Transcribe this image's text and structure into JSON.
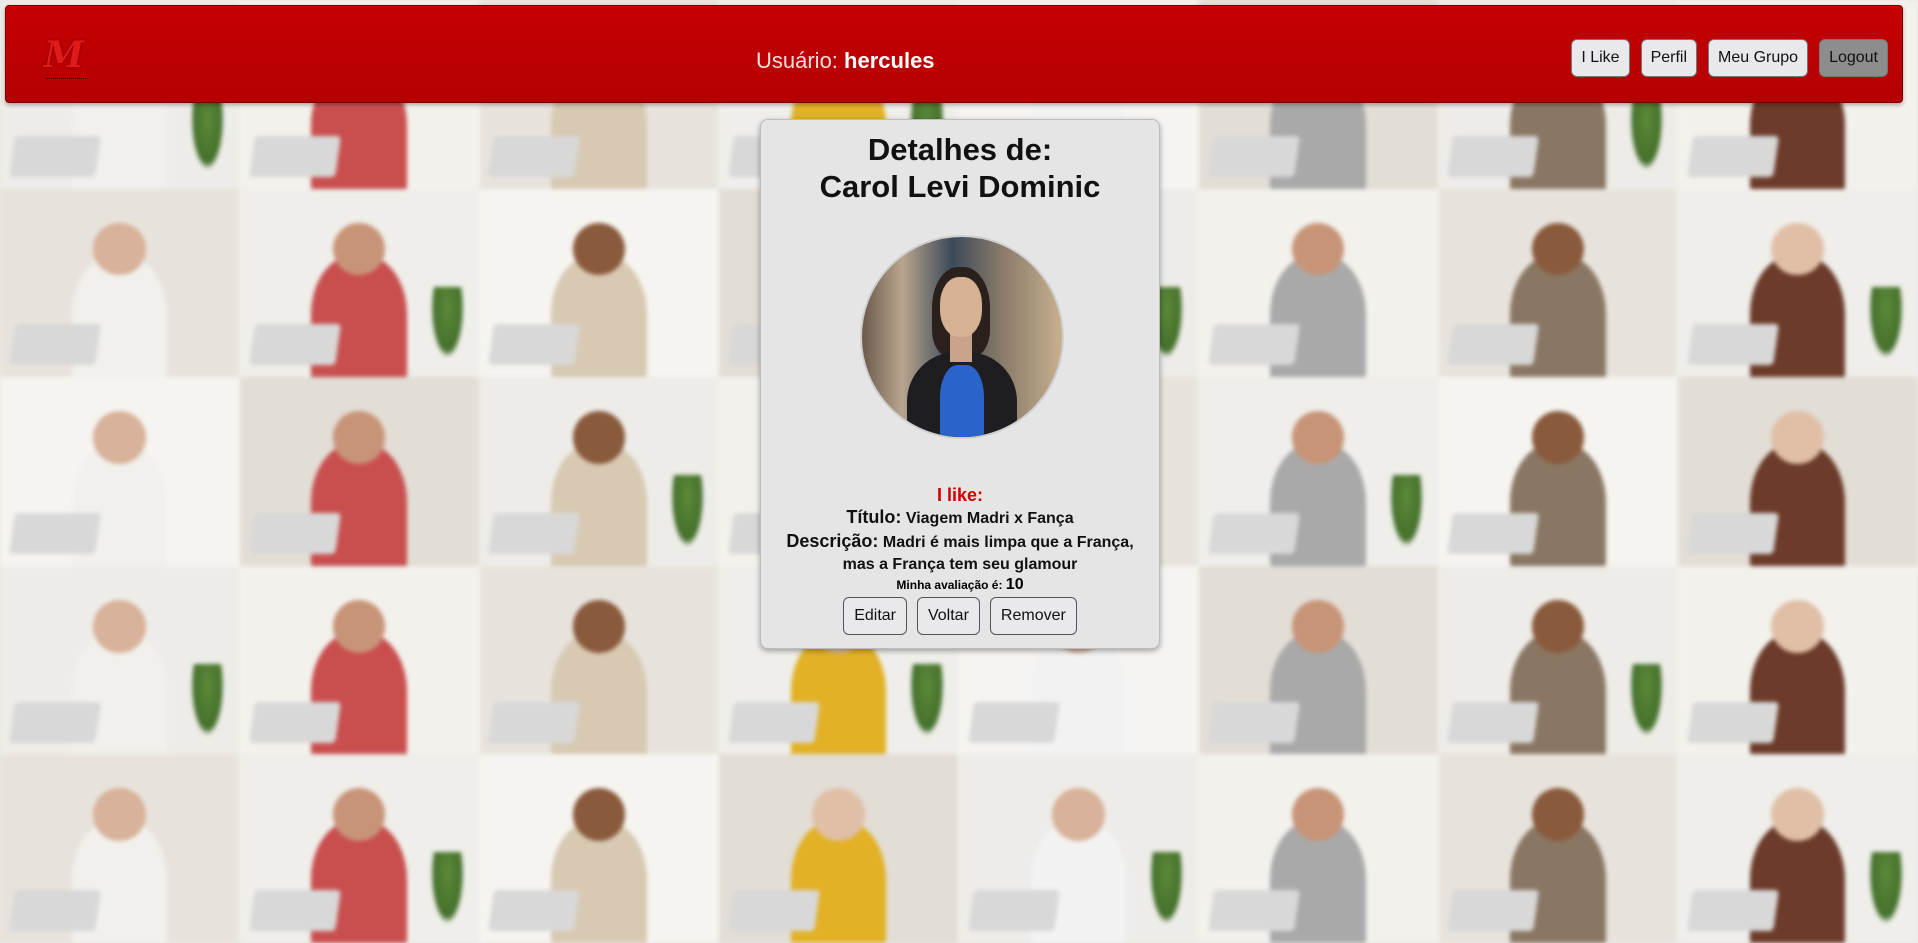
{
  "header": {
    "logo_letter": "M",
    "user_prefix": "Usuário:",
    "username": "hercules",
    "nav": {
      "ilike": "I Like",
      "perfil": "Perfil",
      "meu_grupo": "Meu Grupo",
      "logout": "Logout"
    }
  },
  "card": {
    "title_line1": "Detalhes de:",
    "title_line2": "Carol Levi Dominic",
    "ilike_label": "I like:",
    "titulo_label": "Título:",
    "titulo_value": "Viagem Madri x Fança",
    "descricao_label": "Descrição:",
    "descricao_value_1": "Madri é mais limpa que a França,",
    "descricao_value_2": "mas a França tem seu glamour",
    "rating_label": "Minha avaliação é:",
    "rating_value": "10",
    "buttons": {
      "editar": "Editar",
      "voltar": "Voltar",
      "remover": "Remover"
    }
  },
  "colors": {
    "header_red": "#c60004",
    "ilike_red": "#cc0000",
    "card_bg": "#e5e5e5"
  }
}
